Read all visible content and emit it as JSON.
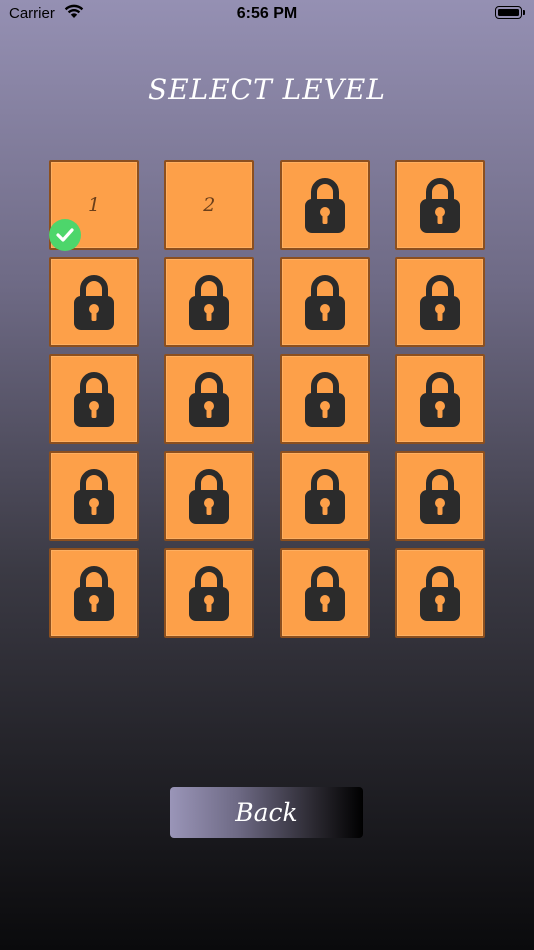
{
  "status_bar": {
    "carrier": "Carrier",
    "time": "6:56 PM",
    "icons": [
      "wifi-icon",
      "battery-icon"
    ]
  },
  "title": "SELECT LEVEL",
  "levels": [
    {
      "label": "1",
      "locked": false,
      "completed": true
    },
    {
      "label": "2",
      "locked": false,
      "completed": false
    },
    {
      "label": "",
      "locked": true
    },
    {
      "label": "",
      "locked": true
    },
    {
      "label": "",
      "locked": true
    },
    {
      "label": "",
      "locked": true
    },
    {
      "label": "",
      "locked": true
    },
    {
      "label": "",
      "locked": true
    },
    {
      "label": "",
      "locked": true
    },
    {
      "label": "",
      "locked": true
    },
    {
      "label": "",
      "locked": true
    },
    {
      "label": "",
      "locked": true
    },
    {
      "label": "",
      "locked": true
    },
    {
      "label": "",
      "locked": true
    },
    {
      "label": "",
      "locked": true
    },
    {
      "label": "",
      "locked": true
    },
    {
      "label": "",
      "locked": true
    },
    {
      "label": "",
      "locked": true
    },
    {
      "label": "",
      "locked": true
    },
    {
      "label": "",
      "locked": true
    }
  ],
  "back_button": {
    "label": "Back"
  },
  "colors": {
    "tile": "#fda049",
    "tile_border": "#8c4f1e",
    "lock": "#2b2b2b",
    "check": "#4dd66b"
  }
}
